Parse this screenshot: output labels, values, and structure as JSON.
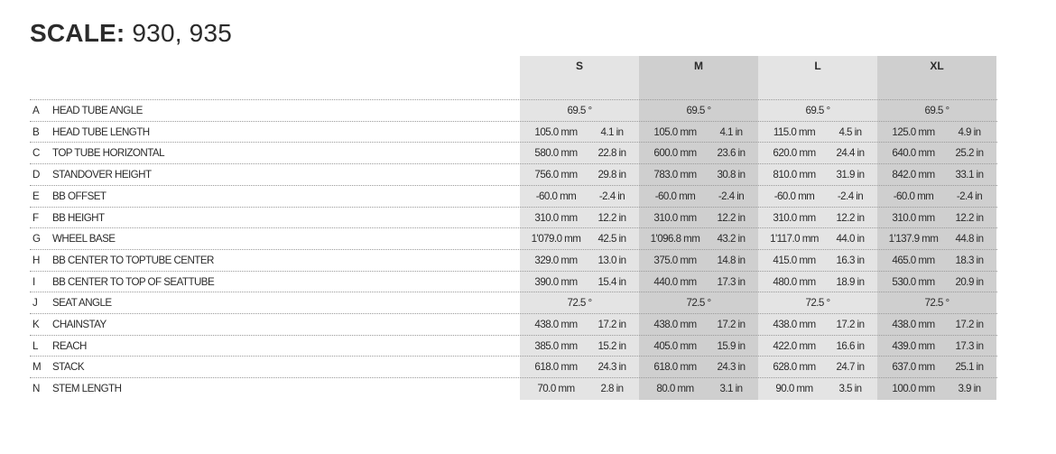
{
  "title": {
    "brand": "SCALE:",
    "models": "930, 935"
  },
  "sizes": [
    "S",
    "M",
    "L",
    "XL"
  ],
  "rows": [
    {
      "letter": "A",
      "label": "HEAD TUBE ANGLE",
      "angle": [
        "69.5 °",
        "69.5 °",
        "69.5 °",
        "69.5 °"
      ]
    },
    {
      "letter": "B",
      "label": "HEAD TUBE LENGTH",
      "mm": [
        "105.0 mm",
        "105.0 mm",
        "115.0 mm",
        "125.0 mm"
      ],
      "in": [
        "4.1 in",
        "4.1 in",
        "4.5 in",
        "4.9 in"
      ]
    },
    {
      "letter": "C",
      "label": "TOP TUBE HORIZONTAL",
      "mm": [
        "580.0 mm",
        "600.0 mm",
        "620.0 mm",
        "640.0 mm"
      ],
      "in": [
        "22.8 in",
        "23.6 in",
        "24.4 in",
        "25.2 in"
      ]
    },
    {
      "letter": "D",
      "label": "STANDOVER HEIGHT",
      "mm": [
        "756.0 mm",
        "783.0 mm",
        "810.0 mm",
        "842.0 mm"
      ],
      "in": [
        "29.8 in",
        "30.8 in",
        "31.9 in",
        "33.1 in"
      ]
    },
    {
      "letter": "E",
      "label": "BB OFFSET",
      "mm": [
        "-60.0 mm",
        "-60.0 mm",
        "-60.0 mm",
        "-60.0 mm"
      ],
      "in": [
        "-2.4 in",
        "-2.4 in",
        "-2.4 in",
        "-2.4 in"
      ]
    },
    {
      "letter": "F",
      "label": "BB HEIGHT",
      "mm": [
        "310.0 mm",
        "310.0 mm",
        "310.0 mm",
        "310.0 mm"
      ],
      "in": [
        "12.2 in",
        "12.2 in",
        "12.2 in",
        "12.2 in"
      ]
    },
    {
      "letter": "G",
      "label": "WHEEL BASE",
      "mm": [
        "1'079.0 mm",
        "1'096.8 mm",
        "1'117.0 mm",
        "1'137.9 mm"
      ],
      "in": [
        "42.5 in",
        "43.2 in",
        "44.0 in",
        "44.8 in"
      ]
    },
    {
      "letter": "H",
      "label": "BB CENTER TO TOPTUBE CENTER",
      "mm": [
        "329.0 mm",
        "375.0 mm",
        "415.0 mm",
        "465.0 mm"
      ],
      "in": [
        "13.0 in",
        "14.8 in",
        "16.3 in",
        "18.3 in"
      ]
    },
    {
      "letter": "I",
      "label": "BB CENTER TO TOP OF SEATTUBE",
      "mm": [
        "390.0 mm",
        "440.0 mm",
        "480.0 mm",
        "530.0 mm"
      ],
      "in": [
        "15.4 in",
        "17.3 in",
        "18.9 in",
        "20.9 in"
      ]
    },
    {
      "letter": "J",
      "label": "SEAT ANGLE",
      "angle": [
        "72.5 °",
        "72.5 °",
        "72.5 °",
        "72.5 °"
      ]
    },
    {
      "letter": "K",
      "label": "CHAINSTAY",
      "mm": [
        "438.0 mm",
        "438.0 mm",
        "438.0 mm",
        "438.0 mm"
      ],
      "in": [
        "17.2 in",
        "17.2 in",
        "17.2 in",
        "17.2 in"
      ]
    },
    {
      "letter": "L",
      "label": "REACH",
      "mm": [
        "385.0 mm",
        "405.0 mm",
        "422.0 mm",
        "439.0 mm"
      ],
      "in": [
        "15.2 in",
        "15.9 in",
        "16.6 in",
        "17.3 in"
      ]
    },
    {
      "letter": "M",
      "label": "STACK",
      "mm": [
        "618.0 mm",
        "618.0 mm",
        "628.0 mm",
        "637.0 mm"
      ],
      "in": [
        "24.3 in",
        "24.3 in",
        "24.7 in",
        "25.1 in"
      ]
    },
    {
      "letter": "N",
      "label": "STEM LENGTH",
      "mm": [
        "70.0 mm",
        "80.0 mm",
        "90.0 mm",
        "100.0 mm"
      ],
      "in": [
        "2.8 in",
        "3.1 in",
        "3.5 in",
        "3.9 in"
      ]
    }
  ]
}
